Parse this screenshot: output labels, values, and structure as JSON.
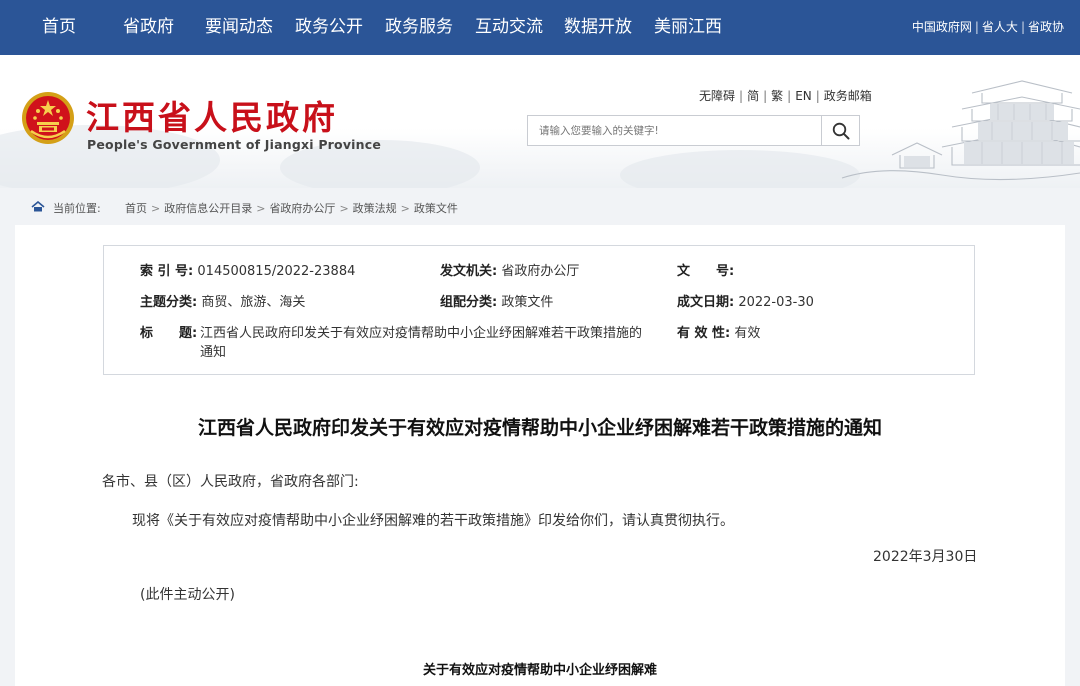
{
  "nav": {
    "items": [
      "首页",
      "省政府",
      "要闻动态",
      "政务公开",
      "政务服务",
      "互动交流",
      "数据开放",
      "美丽江西"
    ],
    "links": [
      "中国政府网",
      "省人大",
      "省政协"
    ]
  },
  "header": {
    "title": "江西省人民政府",
    "subtitle": "People's Government of Jiangxi Province",
    "utils": [
      "无障碍",
      "简",
      "繁",
      "EN",
      "政务邮箱"
    ],
    "search_placeholder": "请输入您要输入的关键字!"
  },
  "breadcrumb": {
    "label": "当前位置:",
    "items": [
      "首页",
      "政府信息公开目录",
      "省政府办公厅",
      "政策法规",
      "政策文件"
    ]
  },
  "info": {
    "index_label": "索 引 号:",
    "index_value": "014500815/2022-23884",
    "issuer_label": "发文机关:",
    "issuer_value": "省政府办公厅",
    "docno_label": "文　　号:",
    "docno_value": "",
    "topic_label": "主题分类:",
    "topic_value": "商贸、旅游、海关",
    "category_label": "组配分类:",
    "category_value": "政策文件",
    "date_label": "成文日期:",
    "date_value": "2022-03-30",
    "title_label": "标　　题:",
    "title_value": "江西省人民政府印发关于有效应对疫情帮助中小企业纾困解难若干政策措施的通知",
    "valid_label": "有 效 性:",
    "valid_value": "有效"
  },
  "document": {
    "title": "江西省人民政府印发关于有效应对疫情帮助中小企业纾困解难若干政策措施的通知",
    "salutation": "各市、县（区）人民政府，省政府各部门:",
    "body": "现将《关于有效应对疫情帮助中小企业纾困解难的若干政策措施》印发给你们，请认真贯彻执行。",
    "date": "2022年3月30日",
    "note": "(此件主动公开)",
    "subtitle": "关于有效应对疫情帮助中小企业纾困解难"
  },
  "colors": {
    "nav_bg": "#2b5597",
    "title_red": "#c8101a"
  }
}
